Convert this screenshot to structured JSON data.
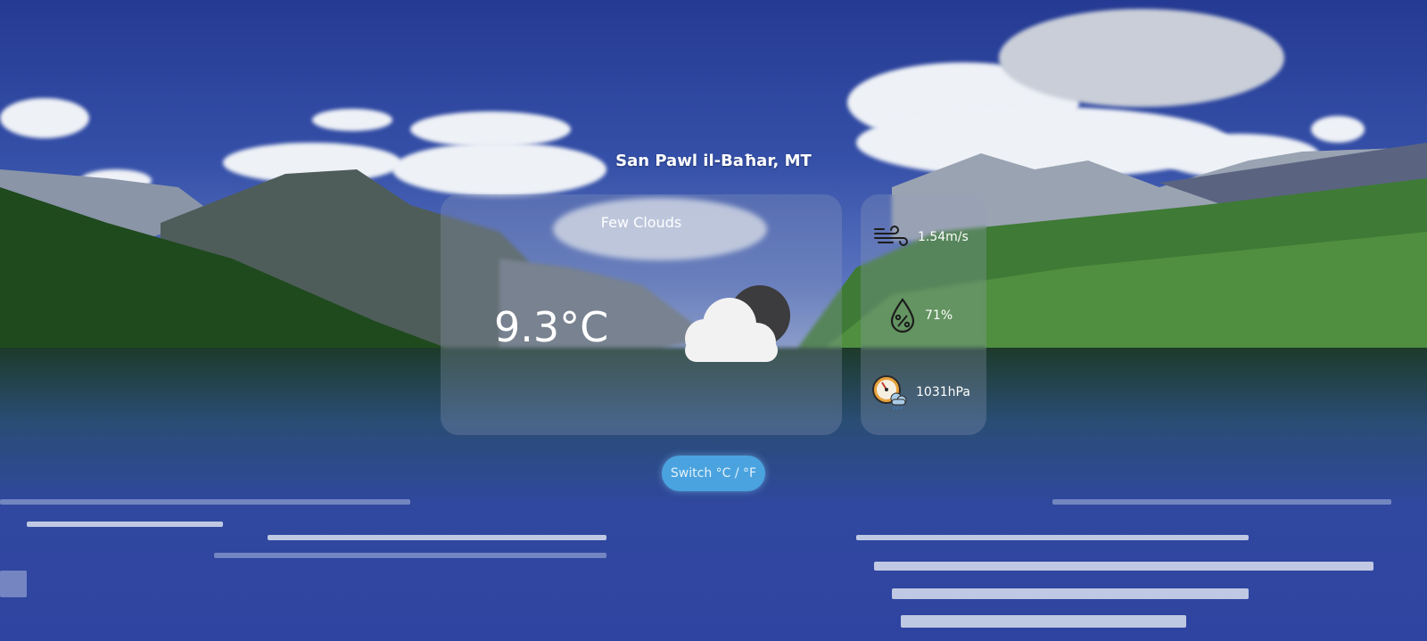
{
  "location": "San Pawl il-Baħar, MT",
  "weather": {
    "description": "Few Clouds",
    "temperature": "9.3°C",
    "icon": "cloud-moon-icon"
  },
  "stats": {
    "wind": {
      "icon": "wind-icon",
      "value": "1.54m/s"
    },
    "humidity": {
      "icon": "humidity-drop-icon",
      "value": "71%"
    },
    "pressure": {
      "icon": "barometer-icon",
      "value": "1031hPa"
    }
  },
  "switch_button": {
    "label": "Switch °C / °F"
  },
  "colors": {
    "button": "#4aa3df",
    "card": "rgba(150,160,185,0.28)",
    "text": "#ffffff"
  }
}
